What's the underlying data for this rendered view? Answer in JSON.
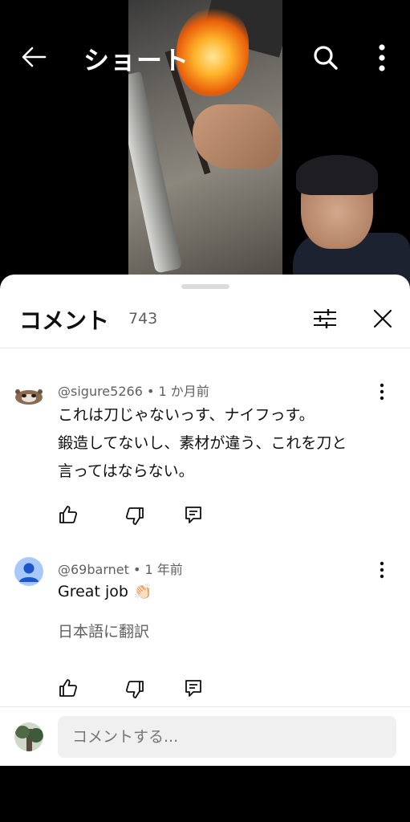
{
  "header": {
    "title": "ショート"
  },
  "comments_panel": {
    "title": "コメント",
    "count": "743"
  },
  "comments": [
    {
      "author": "@sigure5266",
      "time": "1 か月前",
      "lines": [
        "これは刀じゃないっす、ナイフっす。",
        "鍛造してないし、素材が違う、これを刀と",
        "言ってはならない。"
      ]
    },
    {
      "author": "@69barnet",
      "time": "1 年前",
      "text": "Great job 👏🏻",
      "translate_label": "日本語に翻訳"
    }
  ],
  "composer": {
    "placeholder": "コメントする..."
  },
  "colors": {
    "accent_avatar": "#a8c7fa",
    "text_primary": "#0f0f0f",
    "text_secondary": "#606060"
  }
}
